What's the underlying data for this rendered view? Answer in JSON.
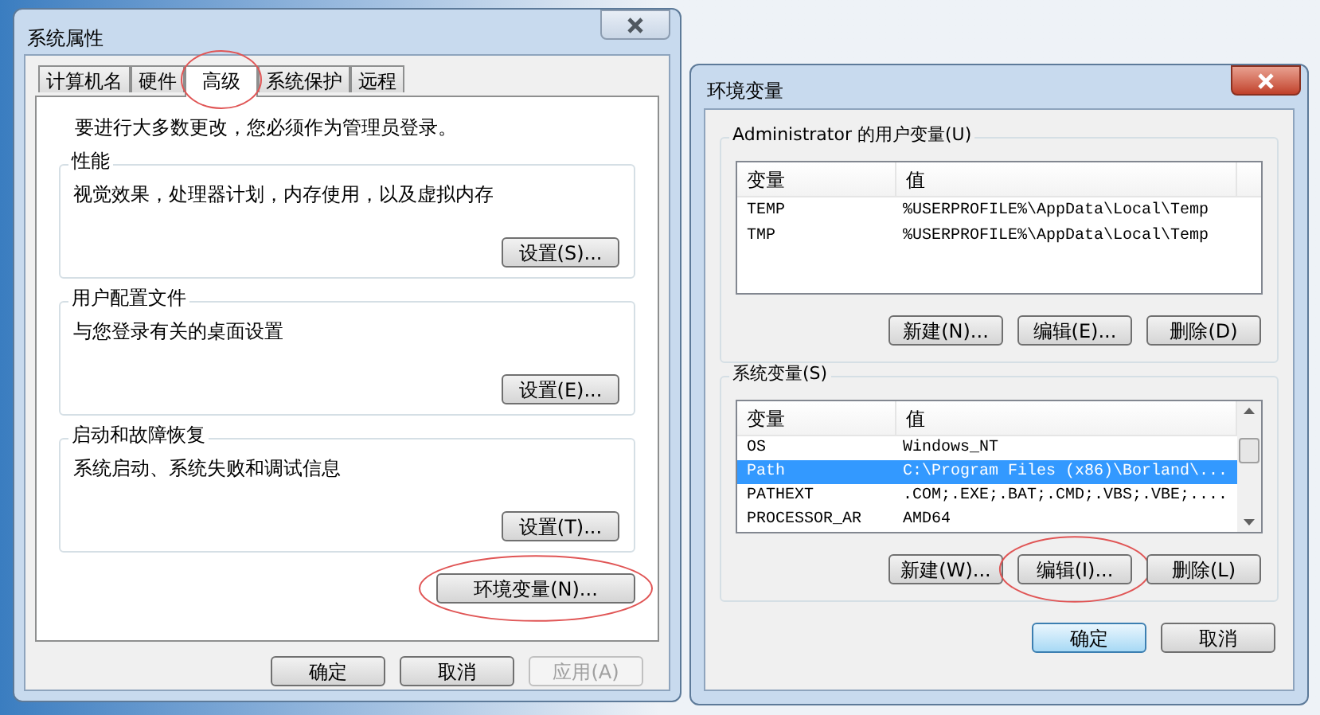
{
  "system_properties": {
    "title": "系统属性",
    "tabs": [
      {
        "label": "计算机名",
        "selected": false,
        "highlighted": false
      },
      {
        "label": "硬件",
        "selected": false,
        "highlighted": false
      },
      {
        "label": "高级",
        "selected": true,
        "highlighted": true
      },
      {
        "label": "系统保护",
        "selected": false,
        "highlighted": false
      },
      {
        "label": "远程",
        "selected": false,
        "highlighted": false
      }
    ],
    "notice": "要进行大多数更改，您必须作为管理员登录。",
    "groups": [
      {
        "title": "性能",
        "description": "视觉效果，处理器计划，内存使用，以及虚拟内存",
        "button": "设置(S)..."
      },
      {
        "title": "用户配置文件",
        "description": "与您登录有关的桌面设置",
        "button": "设置(E)..."
      },
      {
        "title": "启动和故障恢复",
        "description": "系统启动、系统失败和调试信息",
        "button": "设置(T)..."
      }
    ],
    "env_button": {
      "label": "环境变量(N)...",
      "highlighted": true
    },
    "footer_buttons": [
      {
        "label": "确定",
        "disabled": false
      },
      {
        "label": "取消",
        "disabled": false
      },
      {
        "label": "应用(A)",
        "disabled": true
      }
    ]
  },
  "environment_variables": {
    "title": "环境变量",
    "sections": [
      {
        "title": "Administrator 的用户变量(U)",
        "columns": [
          "变量",
          "值"
        ],
        "scrollbar": false,
        "rows": [
          {
            "name": "TEMP",
            "value": "%USERPROFILE%\\AppData\\Local\\Temp",
            "selected": false
          },
          {
            "name": "TMP",
            "value": "%USERPROFILE%\\AppData\\Local\\Temp",
            "selected": false
          }
        ],
        "buttons": [
          {
            "label": "新建(N)...",
            "highlighted": false
          },
          {
            "label": "编辑(E)...",
            "highlighted": false
          },
          {
            "label": "删除(D)",
            "highlighted": false
          }
        ]
      },
      {
        "title": "系统变量(S)",
        "columns": [
          "变量",
          "值"
        ],
        "scrollbar": true,
        "rows": [
          {
            "name": "OS",
            "value": "Windows_NT",
            "selected": false
          },
          {
            "name": "Path",
            "value": "C:\\Program Files (x86)\\Borland\\...",
            "selected": true
          },
          {
            "name": "PATHEXT",
            "value": ".COM;.EXE;.BAT;.CMD;.VBS;.VBE;....",
            "selected": false
          },
          {
            "name": "PROCESSOR_AR",
            "value": "AMD64",
            "selected": false
          }
        ],
        "buttons": [
          {
            "label": "新建(W)...",
            "highlighted": false
          },
          {
            "label": "编辑(I)...",
            "highlighted": true
          },
          {
            "label": "删除(L)",
            "highlighted": false
          }
        ]
      }
    ],
    "footer_buttons": [
      {
        "label": "确定",
        "default": true
      },
      {
        "label": "取消",
        "default": false
      }
    ]
  }
}
